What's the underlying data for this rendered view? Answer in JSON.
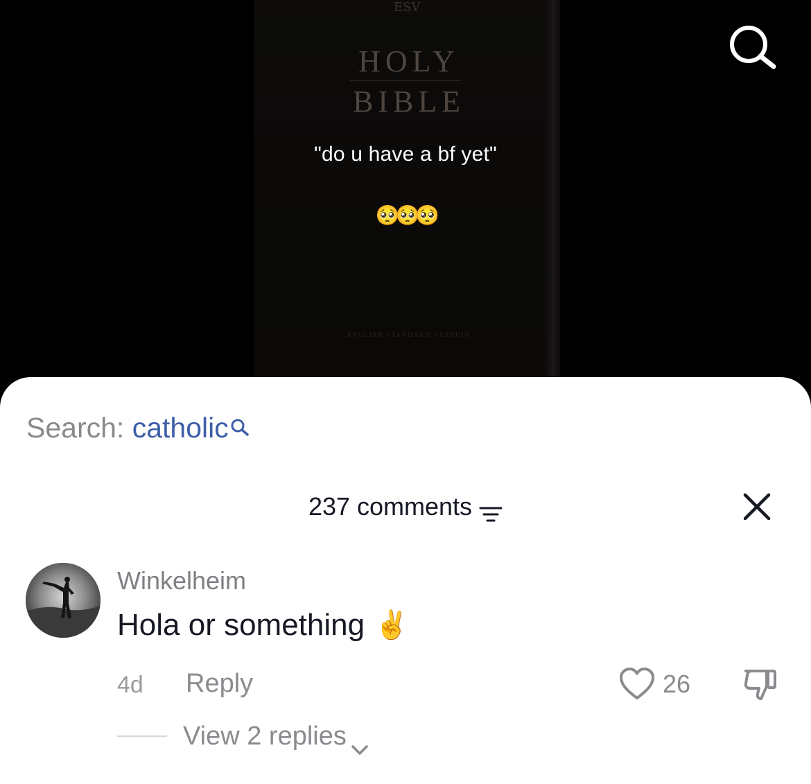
{
  "video": {
    "book_logo": "ESV",
    "book_title_line1": "HOLY",
    "book_title_line2": "BIBLE",
    "book_version": "ENGLISH STANDARD VERSION",
    "overlay_text": "\"do u have a bf yet\"",
    "overlay_emoji": "🥺🥺🥺",
    "search_icon": "search-icon"
  },
  "sheet": {
    "search_suggestion": {
      "label": "Search: ",
      "term": "catholic",
      "icon": "search-icon"
    },
    "header": {
      "comments_count": "237 comments",
      "filter_icon": "filter-icon",
      "close_icon": "close-icon"
    },
    "comments": [
      {
        "username": "Winkelheim",
        "text": "Hola or something",
        "emoji": "✌️",
        "time": "4d",
        "reply_label": "Reply",
        "likes": "26",
        "like_icon": "heart-icon",
        "dislike_icon": "thumbs-down-icon",
        "view_replies": "View 2 replies"
      }
    ]
  },
  "colors": {
    "search_term": "#3d5ea8",
    "text_primary": "#161823",
    "text_secondary": "#8a8a8f",
    "sheet_bg": "#ffffff",
    "video_bg": "#000000"
  }
}
